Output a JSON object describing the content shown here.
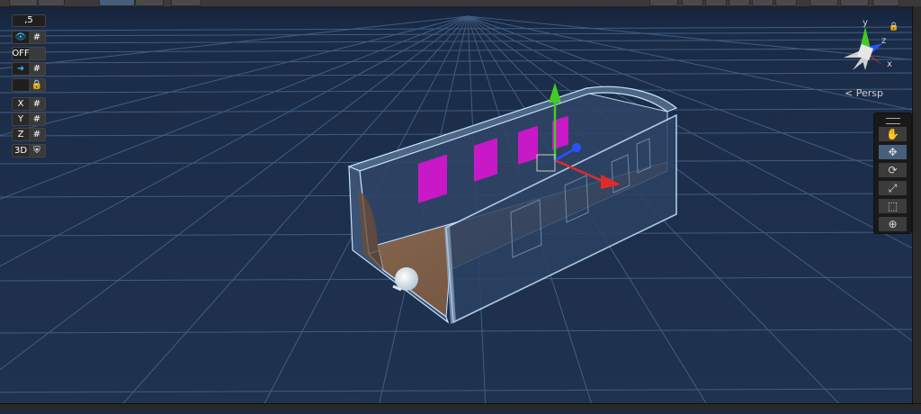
{
  "scene_view": {
    "camera_mode_label": "Persp",
    "gizmo_axes": {
      "x": "x",
      "y": "y",
      "z": "z"
    }
  },
  "overlay_left": {
    "snap_increment": ",5",
    "toggle_off_label": "OFF",
    "axis_labels": [
      "X",
      "Y",
      "Z"
    ],
    "mode_3d_label": "3D"
  },
  "tools": [
    {
      "name": "hand-tool",
      "icon": "hand-icon",
      "glyph": "✋",
      "active": false
    },
    {
      "name": "move-tool",
      "icon": "move-icon",
      "glyph": "✥",
      "active": true
    },
    {
      "name": "rotate-tool",
      "icon": "rotate-icon",
      "glyph": "⟳",
      "active": false
    },
    {
      "name": "scale-tool",
      "icon": "scale-icon",
      "glyph": "⤢",
      "active": false
    },
    {
      "name": "rect-tool",
      "icon": "rect-icon",
      "glyph": "⬚",
      "active": false
    },
    {
      "name": "transform-tool",
      "icon": "transform-icon",
      "glyph": "⊕",
      "active": false
    }
  ],
  "colors": {
    "background": "#1c2b44",
    "grid": "#4a6a8f",
    "window_magenta": "#c818c8",
    "floor_wood": "#7a5a44",
    "selection_outline": "#c8e4ff",
    "axis_x": "#e12b2b",
    "axis_y": "#44cc22",
    "axis_z": "#2a52ff",
    "accent_blue": "#3bb7ff"
  }
}
